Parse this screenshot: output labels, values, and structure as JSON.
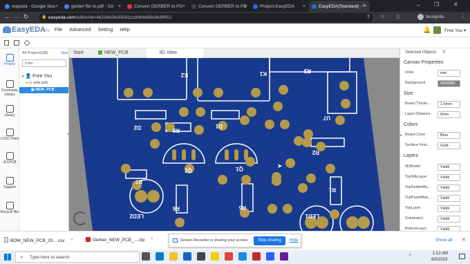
{
  "browser": {
    "tabs": [
      {
        "label": "wayeda - Google Sea",
        "favicon_color": "#4285f4",
        "active": false
      },
      {
        "label": "gerber file to pdf - Go",
        "favicon_color": "#4285f4",
        "active": false
      },
      {
        "label": "Convert GERBER to PD",
        "favicon_color": "#e53935",
        "active": false
      },
      {
        "label": "Convert GERBER to PD",
        "favicon_color": "#444",
        "active": false
      },
      {
        "label": "Project-EasyEDA",
        "favicon_color": "#1a73e8",
        "active": false
      },
      {
        "label": "EasyEDA(Standard) -",
        "favicon_color": "#1a73e8",
        "active": true
      }
    ],
    "url_host": "easyeda.com",
    "url_path": "/editor#id=4b216b2fe30541ccb964d99c9e38ff12",
    "profile_label": "Incognito"
  },
  "app": {
    "logo": "EasyEDA",
    "logo_suffix": "STD",
    "menu": [
      "File",
      "Advanced",
      "Setting",
      "Help"
    ],
    "user_label": "Free You",
    "user_caret": "▾"
  },
  "left_rail": [
    {
      "label": "Project",
      "icon": "folder-icon"
    },
    {
      "label": "Commonly Library",
      "icon": "chip-icon"
    },
    {
      "label": "Library",
      "icon": "library-search-icon"
    },
    {
      "label": "LCSC Parts",
      "icon": "lcsc-icon"
    },
    {
      "label": "JLCPCB",
      "icon": "jlcpcb-icon"
    },
    {
      "label": "Support",
      "icon": "help-icon"
    },
    {
      "label": "Recycle Bin",
      "icon": "trash-icon"
    }
  ],
  "project_panel": {
    "tab_all": "All Projects(38)",
    "tab_open": "Ope",
    "filter_placeholder": "Filter",
    "tree": {
      "root": "Free You",
      "project": "only pcb",
      "file": "NEW_PCB"
    }
  },
  "doc_tabs": [
    {
      "label": "Start",
      "active": false
    },
    {
      "label": "NEW_PCB",
      "active": false
    },
    {
      "label": "3D View",
      "active": true
    }
  ],
  "pcb": {
    "board_color": "#173a8f",
    "pad_color": "#b49a4a",
    "silk_color": "#ffffff",
    "refs": [
      "R3",
      "K2",
      "K1",
      "R3",
      "U7",
      "D2",
      "D1",
      "R8",
      "R2",
      "Q2",
      "Q1",
      "R7",
      "R1",
      "R6",
      "R5",
      "LED2",
      "LED1"
    ]
  },
  "right_panel": {
    "selected_label": "Selected Objects",
    "selected_count": "0",
    "canvas_props": "Canvas Properties",
    "units_label": "Units",
    "units_value": "mm",
    "background_label": "Background",
    "background_value": "#808080",
    "size_section": "Size",
    "board_thickness_label": "Board Thickn...",
    "board_thickness_value": "1.6mm",
    "layer_distance_label": "Layer Distance",
    "layer_distance_value": "0mm",
    "colors_section": "Colors",
    "board_color_label": "Board Color",
    "board_color_value": "Blue",
    "surface_finish_label": "Surface Finis...",
    "surface_finish_value": "Gold",
    "layers_section": "Layers",
    "layers": [
      {
        "label": "3DModel",
        "value": "Visibl"
      },
      {
        "label": "TopSilkLayer",
        "value": "Visibl"
      },
      {
        "label": "TopSolderMa...",
        "value": "Visibl"
      },
      {
        "label": "TopPasteMas...",
        "value": "Visibl"
      },
      {
        "label": "TopLayer",
        "value": "Visibl"
      },
      {
        "label": "Substrate1",
        "value": "Visibl"
      },
      {
        "label": "BottomLayer",
        "value": "Visibl"
      }
    ]
  },
  "downloads": {
    "items": [
      "BOM_NEW_PCB_20....csv",
      "Gerber_NEW_PCB_....zip"
    ],
    "show_all": "Show all"
  },
  "share_bar": {
    "message": "Screen Recorder is sharing your screen.",
    "stop_label": "Stop sharing",
    "hide_label": "Hide"
  },
  "taskbar": {
    "search_placeholder": "Type here to search",
    "time": "1:12 AM",
    "date": "6/5/2023"
  }
}
